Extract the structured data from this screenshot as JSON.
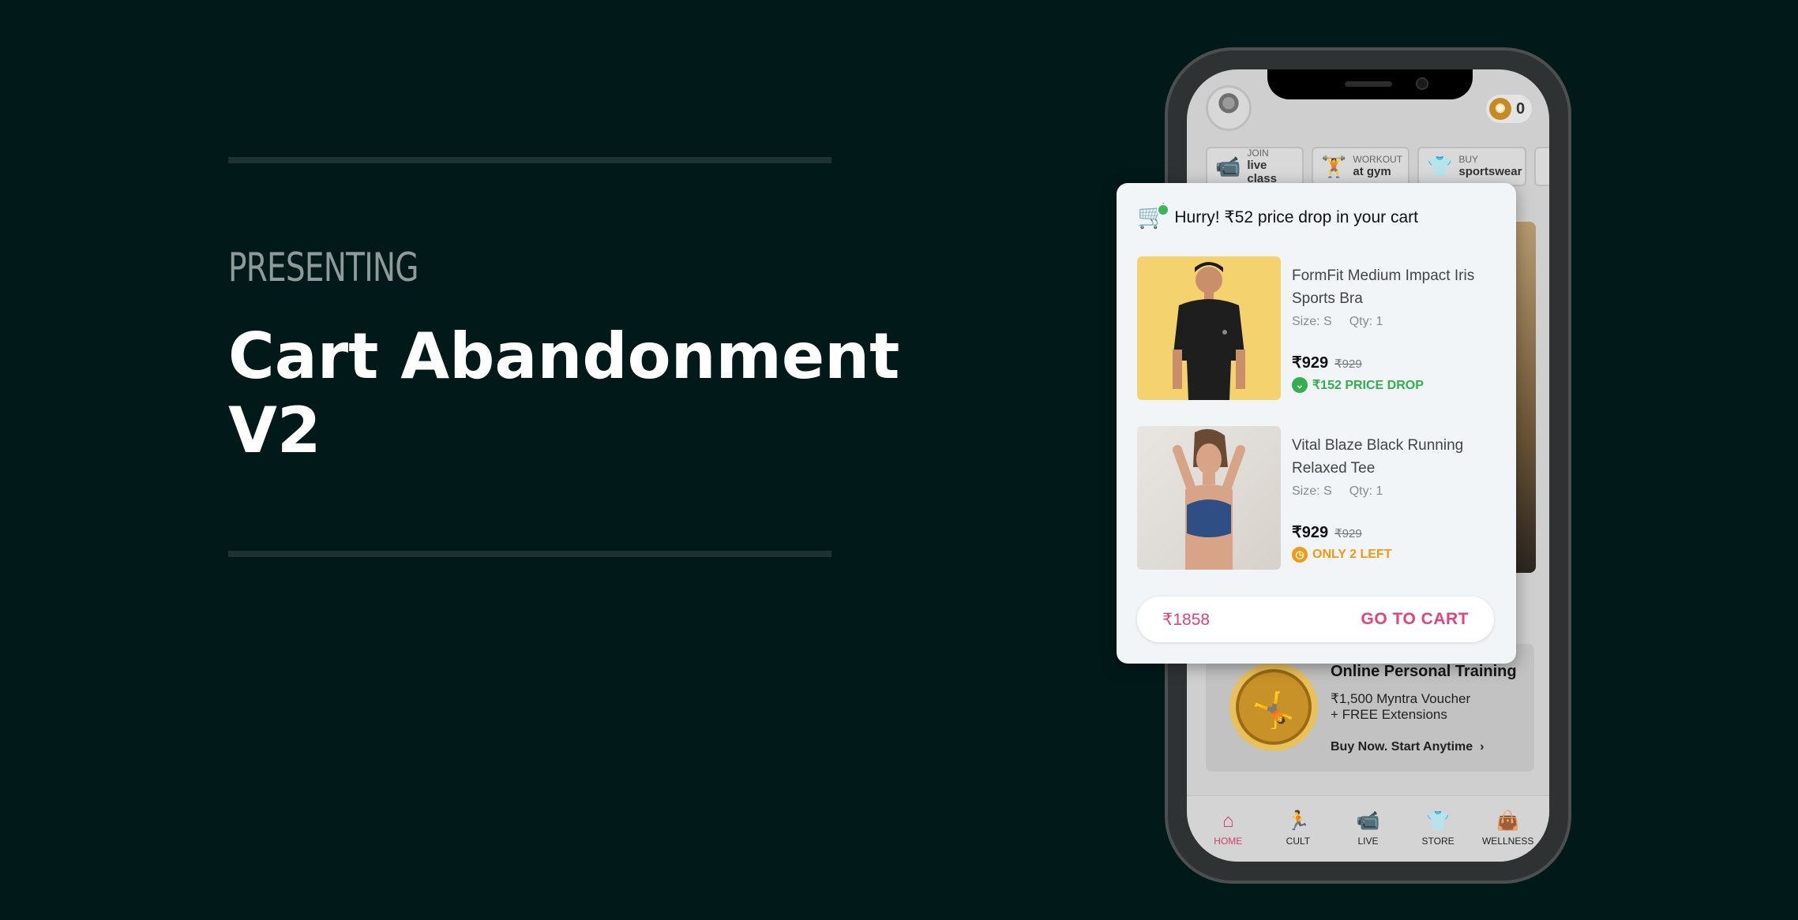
{
  "presentation": {
    "eyebrow": "PRESENTING",
    "title_line1": "Cart Abandonment",
    "title_line2": "V2"
  },
  "phone": {
    "coins": {
      "count": "0",
      "icon": "coin-icon"
    },
    "chips": [
      {
        "small": "JOIN",
        "big": "live class",
        "icon": "video-camera-icon"
      },
      {
        "small": "WORKOUT",
        "big": "at gym",
        "icon": "dumbbell-person-icon"
      },
      {
        "small": "BUY",
        "big": "sportswear",
        "icon": "tshirt-icon"
      }
    ],
    "promo": {
      "title": "Online Personal Training",
      "line1": "₹1,500 Myntra Voucher",
      "line2": "+ FREE Extensions",
      "cta": "Buy Now. Start Anytime",
      "cta_icon": "chevron-right-icon"
    },
    "tabs": [
      {
        "label": "HOME",
        "icon": "home-icon",
        "active": true
      },
      {
        "label": "CULT",
        "icon": "running-person-icon",
        "active": false
      },
      {
        "label": "LIVE",
        "icon": "video-camera-icon",
        "active": false
      },
      {
        "label": "STORE",
        "icon": "tshirt-icon",
        "active": false
      },
      {
        "label": "WELLNESS",
        "icon": "bag-icon",
        "active": false
      }
    ]
  },
  "cart": {
    "icon": "cart-icon",
    "heading": "Hurry! ₹52 price drop in your cart",
    "items": [
      {
        "name": "FormFit Medium Impact Iris Sports Bra",
        "size": "Size: S",
        "qty": "Qty: 1",
        "price": "₹929",
        "mrp": "₹929",
        "badge": "₹152 PRICE DROP",
        "badge_icon": "chevron-down-circle-icon",
        "badge_color": "#32b04d"
      },
      {
        "name": "Vital Blaze Black Running Relaxed Tee",
        "size": "Size: S",
        "qty": "Qty: 1",
        "price": "₹929",
        "mrp": "₹929",
        "badge": "ONLY 2 LEFT",
        "badge_icon": "clock-icon",
        "badge_color": "#f39a12"
      }
    ],
    "total": "₹1858",
    "cta": "GO TO CART",
    "accent": "#e6427a"
  }
}
